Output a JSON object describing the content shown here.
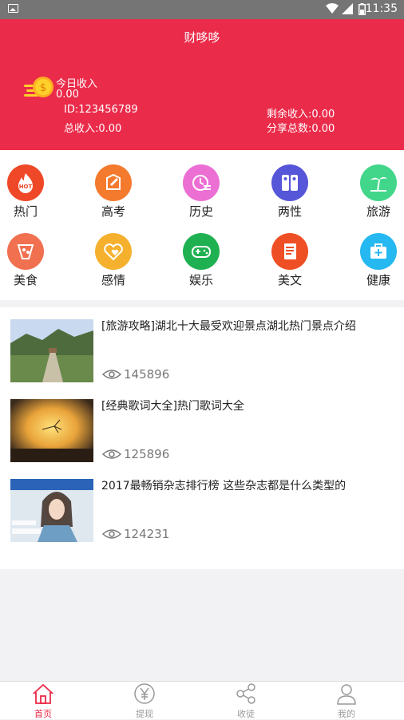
{
  "status_bar": {
    "time": "11:35",
    "icons": [
      "image-icon",
      "wifi-icon",
      "signal-icon",
      "battery-icon"
    ]
  },
  "header": {
    "title": "财哆哆",
    "today_label": "今日收入",
    "today_value": "0.00",
    "id_text": "ID:123456789",
    "total_income": "总收入:0.00",
    "remaining_income": "剩余收入:0.00",
    "share_total": "分享总数:0.00",
    "background": "#ea2b4a"
  },
  "categories": [
    {
      "label": "热门",
      "color": "#ef4828",
      "icon": "hot-icon"
    },
    {
      "label": "高考",
      "color": "#f47a2e",
      "icon": "pen-icon"
    },
    {
      "label": "历史",
      "color": "#ec6fd4",
      "icon": "history-icon"
    },
    {
      "label": "两性",
      "color": "#5656d9",
      "icon": "gender-icon"
    },
    {
      "label": "旅游",
      "color": "#41d68a",
      "icon": "palm-icon"
    },
    {
      "label": "美食",
      "color": "#f0704f",
      "icon": "food-icon"
    },
    {
      "label": "感情",
      "color": "#f5b12e",
      "icon": "heart-icon"
    },
    {
      "label": "娱乐",
      "color": "#1fb151",
      "icon": "gamepad-icon"
    },
    {
      "label": "美文",
      "color": "#ef4f24",
      "icon": "notebook-icon"
    },
    {
      "label": "健康",
      "color": "#26b8f0",
      "icon": "medkit-icon"
    }
  ],
  "articles": [
    {
      "title": "[旅游攻略]湖北十大最受欢迎景点湖北热门景点介绍",
      "views": "145896"
    },
    {
      "title": "[经典歌词大全]热门歌词大全",
      "views": "125896"
    },
    {
      "title": "2017最畅销杂志排行榜 这些杂志都是什么类型的",
      "views": "124231"
    }
  ],
  "tabbar": [
    {
      "label": "首页",
      "icon": "home-icon",
      "active": true
    },
    {
      "label": "提现",
      "icon": "yen-icon",
      "active": false
    },
    {
      "label": "收徒",
      "icon": "share-icon",
      "active": false
    },
    {
      "label": "我的",
      "icon": "user-icon",
      "active": false
    }
  ],
  "colors": {
    "accent": "#ea2b4a",
    "tab_inactive": "#999999"
  }
}
